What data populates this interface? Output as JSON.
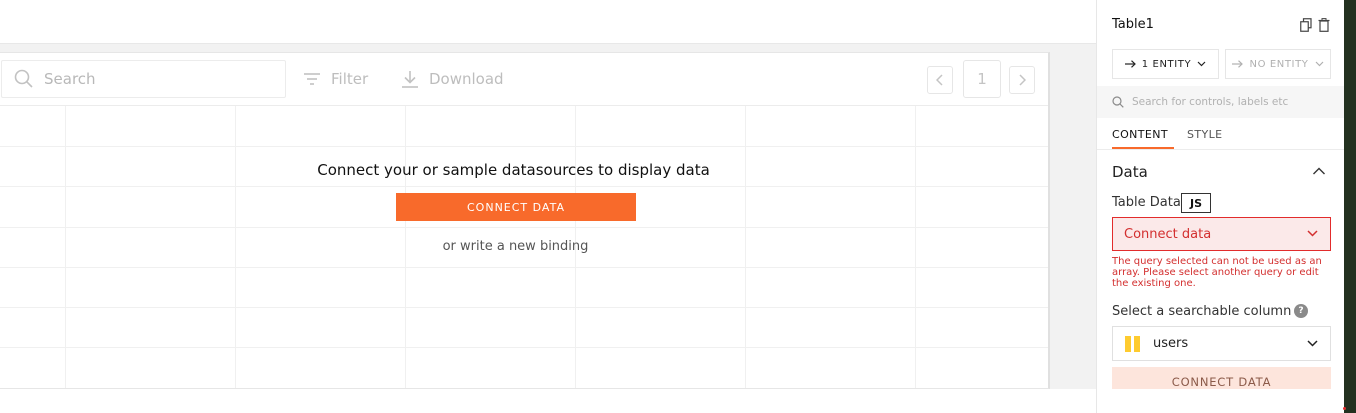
{
  "canvas": {
    "search_placeholder": "Search",
    "filter_label": "Filter",
    "download_label": "Download",
    "page_number": "1",
    "empty_title": "Connect your or sample datasources to display data",
    "connect_button": "CONNECT DATA",
    "binding_link": "or write a new binding"
  },
  "pane": {
    "widget_name": "Table1",
    "entity_left": "1 ENTITY",
    "entity_right": "NO ENTITY",
    "search_placeholder": "Search for controls, labels etc",
    "tabs": [
      {
        "label": "CONTENT",
        "active": true
      },
      {
        "label": "STYLE",
        "active": false
      }
    ],
    "section_title": "Data",
    "table_data_label": "Table Data",
    "js_label": "JS",
    "datasource_value": "Connect data",
    "error_message": "The query selected can not be used as an array. Please select another query or edit the existing one.",
    "searchable_column_label": "Select a searchable column",
    "searchable_column_value": "users",
    "connect_button": "CONNECT DATA"
  },
  "colors": {
    "accent": "#f86a2b",
    "error": "#d32f2f",
    "error_bg": "#fbe9e9",
    "table_icon": "#fecb2f"
  },
  "icons": [
    "search-icon",
    "filter-icon",
    "download-icon",
    "chevron-left-icon",
    "chevron-right-icon",
    "copy-icon",
    "delete-icon",
    "arrow-right-icon",
    "chevron-down-icon",
    "chevron-up-icon",
    "help-icon",
    "table-icon"
  ]
}
